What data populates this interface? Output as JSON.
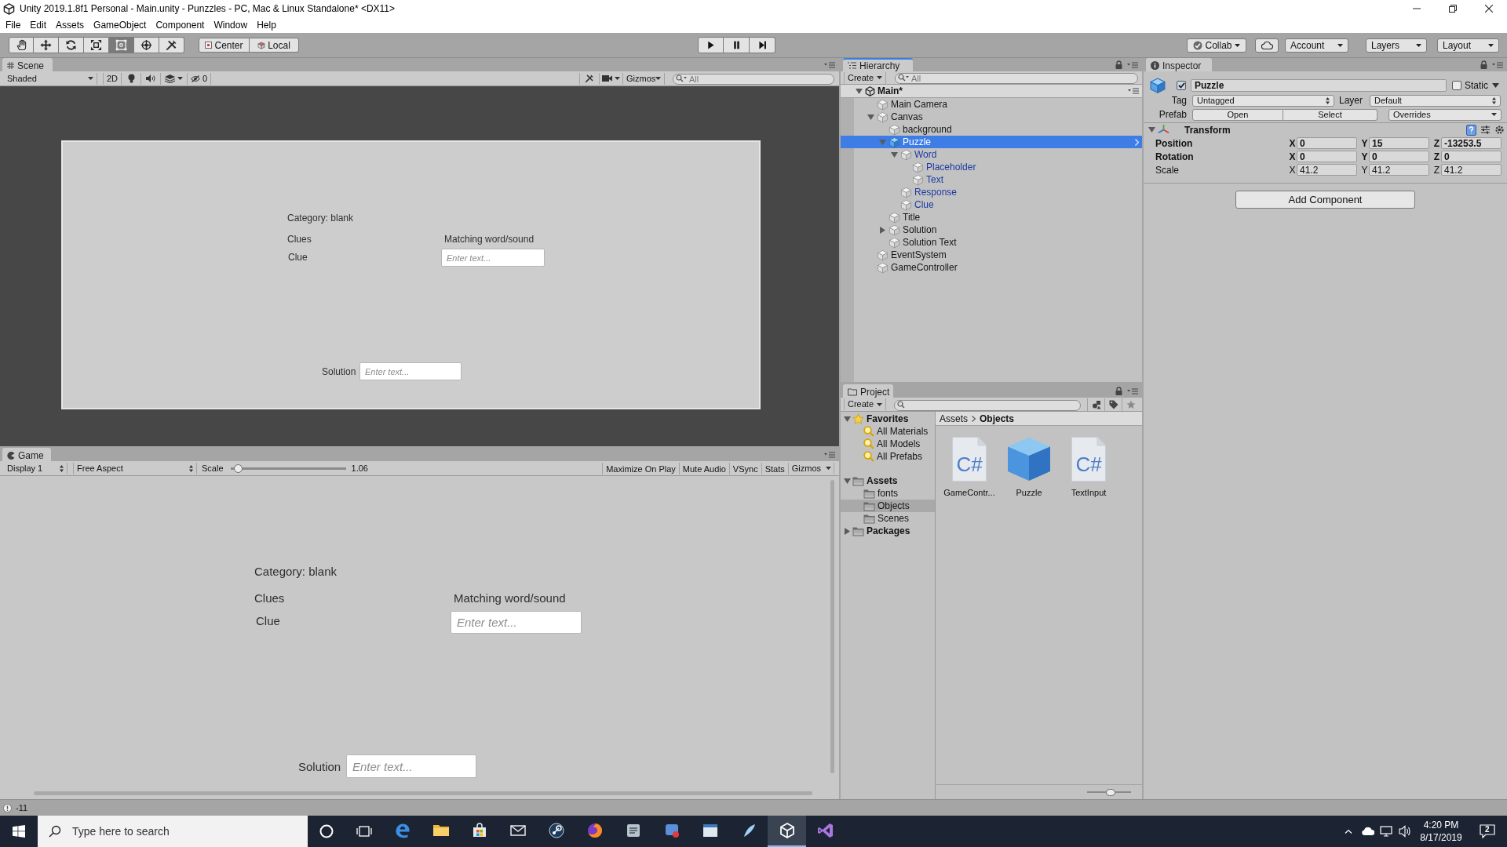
{
  "window": {
    "title": "Unity 2019.1.8f1 Personal - Main.unity - Punzzles - PC, Mac & Linux Standalone* <DX11>"
  },
  "menu": [
    "File",
    "Edit",
    "Assets",
    "GameObject",
    "Component",
    "Window",
    "Help"
  ],
  "toolbar": {
    "tools": [
      {
        "kind": "hand",
        "selected": false
      },
      {
        "kind": "move",
        "selected": false
      },
      {
        "kind": "rotate",
        "selected": false
      },
      {
        "kind": "scale",
        "selected": false
      },
      {
        "kind": "rect",
        "selected": true
      },
      {
        "kind": "transform",
        "selected": false
      },
      {
        "kind": "custom",
        "selected": false
      }
    ],
    "pivot": [
      {
        "kind": "center",
        "label": "Center"
      },
      {
        "kind": "local",
        "label": "Local"
      }
    ],
    "playback": [
      {
        "kind": "play",
        "selected": false
      },
      {
        "kind": "pause",
        "selected": false
      },
      {
        "kind": "step",
        "selected": false
      }
    ],
    "services": [
      {
        "kind": "collab",
        "label": "Collab"
      },
      {
        "kind": "cloud"
      },
      {
        "kind": "dropdown",
        "label": "Account"
      },
      {
        "kind": "dropdown",
        "label": "Layers"
      },
      {
        "kind": "dropdown",
        "label": "Layout"
      }
    ]
  },
  "scene": {
    "tab": {
      "label": "Scene",
      "focused": false
    },
    "toolbar": {
      "draw_mode": "Shaded",
      "mode_2d": "2D",
      "toggles": [
        {
          "kind": "lighting",
          "on": false
        },
        {
          "kind": "audio",
          "on": false
        }
      ],
      "hidden_count": "0",
      "gizmos": "Gizmos",
      "search": {
        "placeholder": "All"
      }
    },
    "view": {
      "elements": [
        {
          "kind": "label",
          "text": "Category: blank"
        },
        {
          "kind": "label",
          "text": "Clues"
        },
        {
          "kind": "label",
          "text": "Matching word/sound"
        },
        {
          "kind": "label",
          "text": "Clue"
        },
        {
          "kind": "input",
          "placeholder": "Enter text..."
        },
        {
          "kind": "label",
          "text": "Solution"
        },
        {
          "kind": "input",
          "placeholder": "Enter text..."
        }
      ]
    }
  },
  "game": {
    "tab": {
      "label": "Game",
      "focused": false
    },
    "toolbar": {
      "display": "Display 1",
      "aspect": "Free Aspect",
      "scale": {
        "label": "Scale",
        "level": 0.03,
        "reading": "1.06"
      },
      "toggles": [
        {
          "label": "Maximize On Play",
          "on": false
        },
        {
          "label": "Mute Audio",
          "on": false
        },
        {
          "label": "VSync",
          "on": false
        },
        {
          "label": "Stats",
          "on": false
        }
      ],
      "gizmos": "Gizmos"
    },
    "view": {
      "elements": [
        {
          "kind": "label",
          "text": "Category: blank"
        },
        {
          "kind": "label",
          "text": "Clues"
        },
        {
          "kind": "label",
          "text": "Matching word/sound"
        },
        {
          "kind": "label",
          "text": "Clue"
        },
        {
          "kind": "input",
          "placeholder": "Enter text..."
        },
        {
          "kind": "label",
          "text": "Solution"
        },
        {
          "kind": "input",
          "placeholder": "Enter text..."
        }
      ]
    }
  },
  "hierarchy": {
    "tab": {
      "label": "Hierarchy",
      "focused": true
    },
    "create": "Create",
    "search": {
      "placeholder": "All"
    },
    "scene": {
      "name": "Main*",
      "expanded": true,
      "children": [
        {
          "name": "Main Camera",
          "kind": "object",
          "selected": false
        },
        {
          "name": "Canvas",
          "kind": "object",
          "selected": false,
          "expanded": true,
          "children": [
            {
              "name": "background",
              "kind": "object",
              "selected": false
            },
            {
              "name": "Puzzle",
              "kind": "prefab_root",
              "selected": true,
              "expanded": true,
              "children": [
                {
                  "name": "Word",
                  "kind": "prefab_part",
                  "selected": false,
                  "expanded": true,
                  "children": [
                    {
                      "name": "Placeholder",
                      "kind": "prefab_part",
                      "selected": false
                    },
                    {
                      "name": "Text",
                      "kind": "prefab_part",
                      "selected": false
                    }
                  ]
                },
                {
                  "name": "Response",
                  "kind": "prefab_part",
                  "selected": false
                },
                {
                  "name": "Clue",
                  "kind": "prefab_part",
                  "selected": false
                }
              ]
            },
            {
              "name": "Title",
              "kind": "object",
              "selected": false
            },
            {
              "name": "Solution",
              "kind": "object",
              "selected": false,
              "expanded": false
            },
            {
              "name": "Solution Text",
              "kind": "object",
              "selected": false
            }
          ]
        },
        {
          "name": "EventSystem",
          "kind": "object",
          "selected": false
        },
        {
          "name": "GameController",
          "kind": "object",
          "selected": false
        }
      ]
    }
  },
  "project": {
    "tab": {
      "label": "Project",
      "focused": false
    },
    "create": "Create",
    "tree": [
      {
        "name": "Favorites",
        "kind": "favorites",
        "selected": false,
        "expanded": true,
        "children": [
          {
            "name": "All Materials",
            "kind": "search",
            "selected": false
          },
          {
            "name": "All Models",
            "kind": "search",
            "selected": false
          },
          {
            "name": "All Prefabs",
            "kind": "search",
            "selected": false
          }
        ]
      },
      {
        "name": "Assets",
        "kind": "folder",
        "selected": false,
        "expanded": true,
        "children": [
          {
            "name": "fonts",
            "kind": "folder",
            "selected": false
          },
          {
            "name": "Objects",
            "kind": "folder",
            "selected": true
          },
          {
            "name": "Scenes",
            "kind": "folder",
            "selected": false
          }
        ]
      },
      {
        "name": "Packages",
        "kind": "folder",
        "selected": false,
        "expanded": false
      }
    ],
    "breadcrumb": [
      "Assets",
      "Objects"
    ],
    "assets": [
      {
        "name": "GameContr...",
        "kind": "script",
        "badge": "C#",
        "selected": false
      },
      {
        "name": "Puzzle",
        "kind": "prefab",
        "selected": false
      },
      {
        "name": "TextInput",
        "kind": "script",
        "badge": "C#",
        "selected": false
      }
    ],
    "icon_size": {
      "level": 0.55
    }
  },
  "inspector": {
    "tab": {
      "label": "Inspector",
      "focused": false
    },
    "object": {
      "active": true,
      "name": "Puzzle",
      "static": false,
      "static_label": "Static"
    },
    "tag": {
      "label": "Tag",
      "value": "Untagged"
    },
    "layer": {
      "label": "Layer",
      "value": "Default"
    },
    "prefab": {
      "label": "Prefab",
      "buttons": [
        "Open",
        "Select"
      ],
      "overrides": "Overrides"
    },
    "components": [
      {
        "name": "Transform",
        "expanded": true,
        "properties": [
          {
            "label": "Position",
            "overridden": true,
            "fields": [
              {
                "axis": "X",
                "value": "0"
              },
              {
                "axis": "Y",
                "value": "15"
              },
              {
                "axis": "Z",
                "value": "-13253.5"
              }
            ]
          },
          {
            "label": "Rotation",
            "overridden": true,
            "fields": [
              {
                "axis": "X",
                "value": "0"
              },
              {
                "axis": "Y",
                "value": "0"
              },
              {
                "axis": "Z",
                "value": "0"
              }
            ]
          },
          {
            "label": "Scale",
            "overridden": false,
            "fields": [
              {
                "axis": "X",
                "value": "41.2"
              },
              {
                "axis": "Y",
                "value": "41.2"
              },
              {
                "axis": "Z",
                "value": "41.2"
              }
            ]
          }
        ]
      }
    ],
    "add_component": "Add Component"
  },
  "status_bar": {
    "message": "-11"
  },
  "taskbar": {
    "search": {
      "placeholder": "Type here to search"
    },
    "apps": [
      {
        "kind": "edge",
        "selected": false
      },
      {
        "kind": "explorer",
        "selected": false
      },
      {
        "kind": "store",
        "selected": false
      },
      {
        "kind": "mail",
        "selected": false
      },
      {
        "kind": "steam",
        "selected": false
      },
      {
        "kind": "firefox",
        "selected": false
      },
      {
        "kind": "tool",
        "selected": false
      },
      {
        "kind": "chat",
        "selected": false
      },
      {
        "kind": "window",
        "selected": false
      },
      {
        "kind": "feather",
        "selected": false
      },
      {
        "kind": "unity",
        "selected": true
      },
      {
        "kind": "vs",
        "selected": false
      }
    ],
    "clock": {
      "time": "4:20 PM",
      "date": "8/17/2019"
    },
    "notifications": {
      "count": "2"
    }
  }
}
